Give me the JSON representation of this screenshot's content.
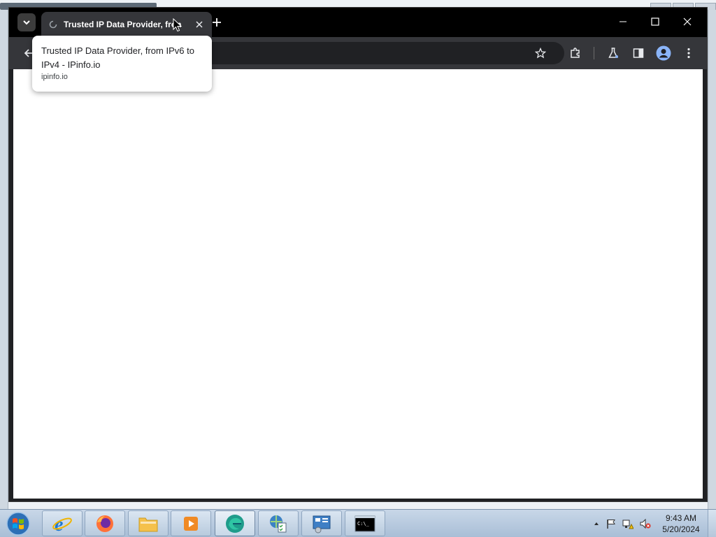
{
  "browser": {
    "tab": {
      "title": "Trusted IP Data Provider, from IPv6 to IPv4 - IPinfo.io",
      "visible_title": "Trusted IP Data Provider, fron"
    },
    "hover_card": {
      "title": "Trusted IP Data Provider, from IPv6 to IPv4 - IPinfo.io",
      "domain": "ipinfo.io"
    },
    "omnibox": {
      "value": ""
    },
    "icons": {
      "tab_search": "chevron-down-icon",
      "new_tab": "plus-icon",
      "back": "arrow-left-icon",
      "bookmark": "star-icon",
      "extensions": "puzzle-icon",
      "labs": "flask-icon",
      "side_panel": "side-panel-icon",
      "profile": "account-icon",
      "menu": "kebab-menu-icon"
    },
    "colors": {
      "titlebar": "#000000",
      "toolbar": "#35363a",
      "omnibox": "#202124",
      "content": "#ffffff"
    }
  },
  "taskbar": {
    "apps": [
      "Internet Explorer",
      "Firefox",
      "File Explorer",
      "Media Player",
      "Edge",
      "Network",
      "Control Panel",
      "Command Prompt"
    ],
    "clock": {
      "time": "9:43 AM",
      "date": "5/20/2024"
    }
  }
}
